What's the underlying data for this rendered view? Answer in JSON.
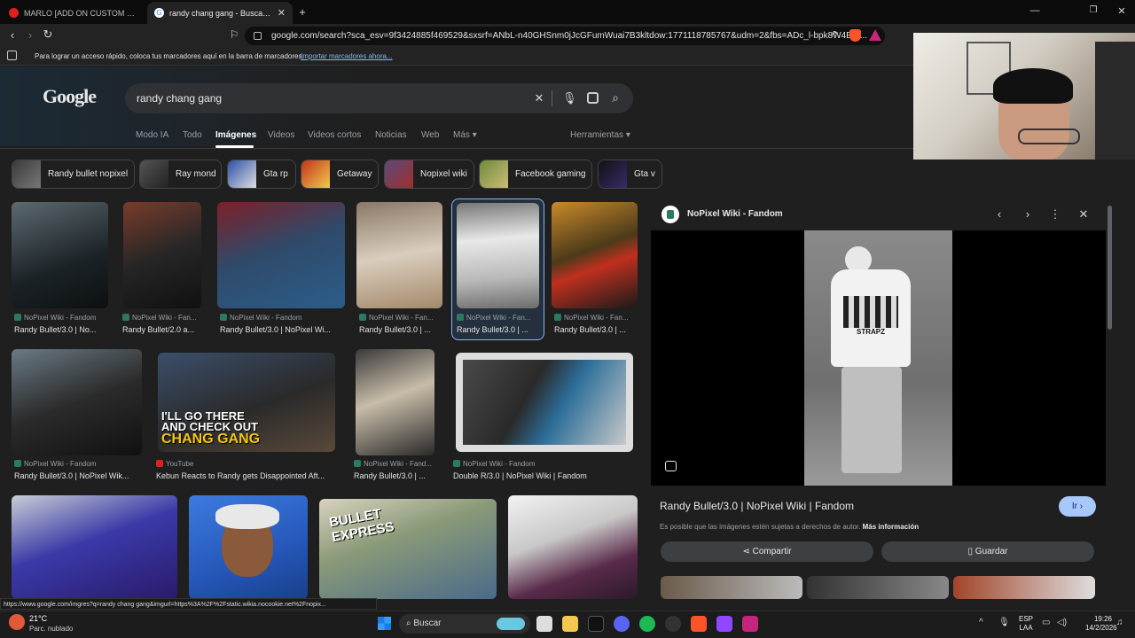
{
  "tabs": [
    {
      "label": "MARLO [ADD ON CUSTOM PED FIVEM]"
    },
    {
      "label": "randy chang gang - Buscar con Google"
    }
  ],
  "toolbar": {
    "url": "google.com/search?sca_esv=9f3424885f469529&sxsrf=ANbL-n40GHSnm0jJcGFumWuai7B3kltdow:1771118785767&udm=2&fbs=ADc_l-bpk8W4E-q..."
  },
  "bookmarks": {
    "text": "Para lograr un acceso rápido, coloca tus marcadores aquí en la barra de marcadores.",
    "link": "Importar marcadores ahora..."
  },
  "search": {
    "logo": "Google",
    "query": "randy chang gang"
  },
  "nav": {
    "tabs": [
      "Modo IA",
      "Todo",
      "Imágenes",
      "Videos",
      "Videos cortos",
      "Noticias",
      "Web",
      "Más"
    ],
    "tools": "Herramientas"
  },
  "chips": [
    "Randy bullet nopixel",
    "Ray mond",
    "Gta rp",
    "Getaway",
    "Nopixel wiki",
    "Facebook gaming",
    "Gta v"
  ],
  "results": [
    {
      "source": "NoPixel Wiki - Fandom",
      "title": "Randy Bullet/3.0 | No..."
    },
    {
      "source": "NoPixel Wiki - Fan...",
      "title": "Randy Bullet/2.0 a..."
    },
    {
      "source": "NoPixel Wiki - Fandom",
      "title": "Randy Bullet/3.0 | NoPixel Wi..."
    },
    {
      "source": "NoPixel Wiki - Fan...",
      "title": "Randy Bullet/3.0 | ..."
    },
    {
      "source": "NoPixel Wiki - Fan...",
      "title": "Randy Bullet/3.0 | ..."
    },
    {
      "source": "NoPixel Wiki - Fan...",
      "title": "Randy Bullet/3.0 | ..."
    },
    {
      "source": "NoPixel Wiki - Fandom",
      "title": "Randy Bullet/3.0 | NoPixel Wik..."
    },
    {
      "source": "YouTube",
      "title": "Kebun Reacts to Randy gets Disappointed Aft..."
    },
    {
      "source": "NoPixel Wiki - Fand...",
      "title": "Randy Bullet/3.0 | ..."
    },
    {
      "source": "NoPixel Wiki - Fandom",
      "title": "Double R/3.0 | NoPixel Wiki | Fandom"
    }
  ],
  "thumb_text": {
    "youtube_line1": "I'LL GO THERE",
    "youtube_line2": "AND CHECK OUT",
    "youtube_line3": "CHANG GANG",
    "hoodie": "STRAPZ",
    "poster": "BULLET EXPRESS"
  },
  "panel": {
    "source": "NoPixel Wiki - Fandom",
    "title": "Randy Bullet/3.0 | NoPixel Wiki | Fandom",
    "go": "Ir",
    "notice": "Es posible que las imágenes estén sujetas a derechos de autor.",
    "more": "Más información",
    "share": "Compartir",
    "save": "Guardar"
  },
  "status": {
    "url": "https://www.google.com/imgres?q=randy chang gang&imgurl=https%3A%2F%2Fstatic.wikia.nocookie.net%2Fnopix..."
  },
  "taskbar": {
    "temp": "21°C",
    "weather": "Parc. nublado",
    "search": "Buscar",
    "lang1": "ESP",
    "lang2": "LAA",
    "time": "19:26",
    "date": "14/2/2026"
  }
}
